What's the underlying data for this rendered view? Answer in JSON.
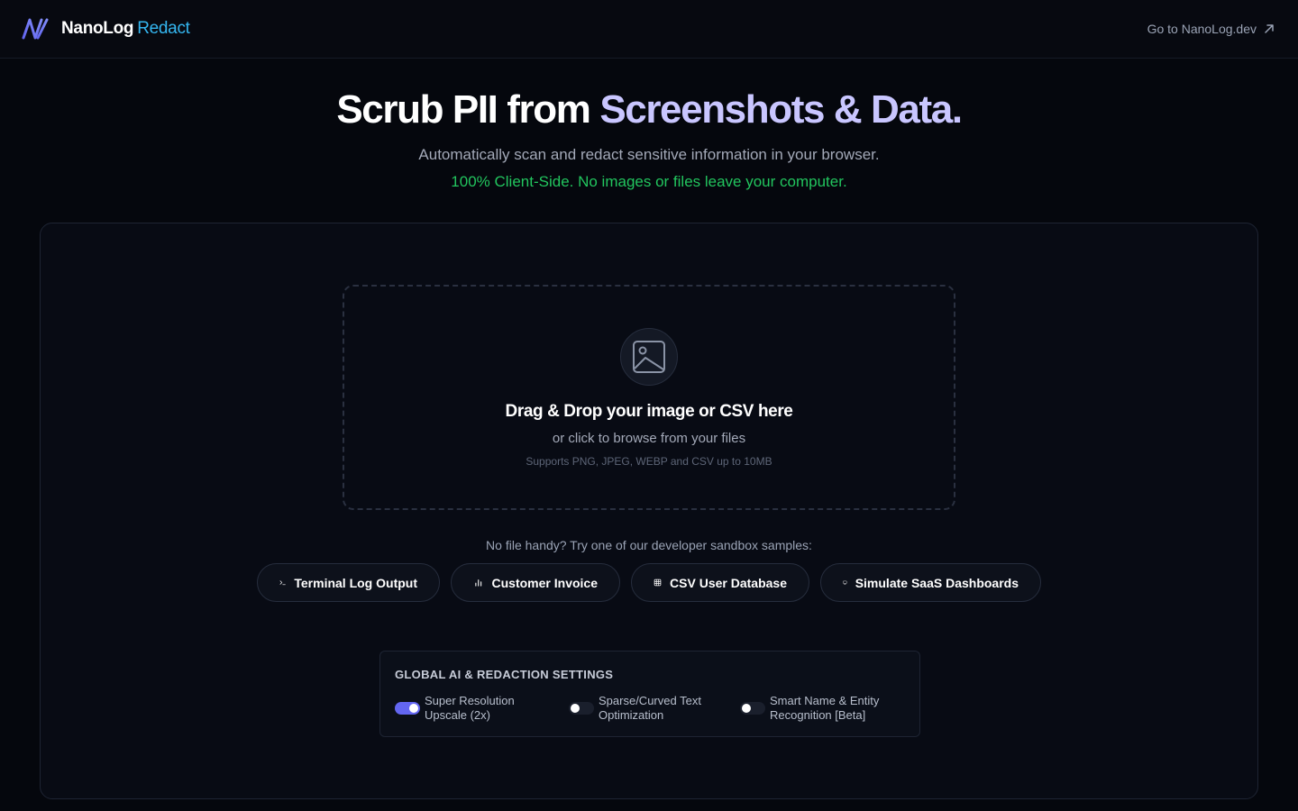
{
  "header": {
    "brand_first": "NanoLog",
    "brand_second": "Redact",
    "external_link": "Go to NanoLog.dev"
  },
  "hero": {
    "title_white": "Scrub PII from ",
    "title_purple": "Screenshots & Data.",
    "subtitle": "Automatically scan and redact sensitive information in your browser.",
    "privacy_note": "100% Client-Side. No images or files leave your computer."
  },
  "dropzone": {
    "title": "Drag & Drop your image or CSV here",
    "subtitle": "or click to browse from your files",
    "note": "Supports PNG, JPEG, WEBP and CSV up to 10MB"
  },
  "samples": {
    "label": "No file handy? Try one of our developer sandbox samples:",
    "items": [
      {
        "label": "Terminal Log Output",
        "icon": "terminal-icon"
      },
      {
        "label": "Customer Invoice",
        "icon": "bar-chart-icon"
      },
      {
        "label": "CSV User Database",
        "icon": "table-grid-icon"
      },
      {
        "label": "Simulate SaaS Dashboards",
        "icon": "monitor-icon"
      }
    ]
  },
  "settings": {
    "title": "GLOBAL AI & REDACTION SETTINGS",
    "toggles": [
      {
        "line1": "Super Resolution",
        "line2": "Upscale (2x)",
        "on": true
      },
      {
        "line1": "Sparse/Curved Text",
        "line2": "Optimization",
        "on": false
      },
      {
        "line1": "Smart Name & Entity",
        "line2": "Recognition [Beta]",
        "on": false
      }
    ]
  },
  "colors": {
    "accent": "#6366f1",
    "brand_blue": "#34b6f0",
    "success": "#22c55e",
    "title_purple": "#c9c6ff"
  }
}
